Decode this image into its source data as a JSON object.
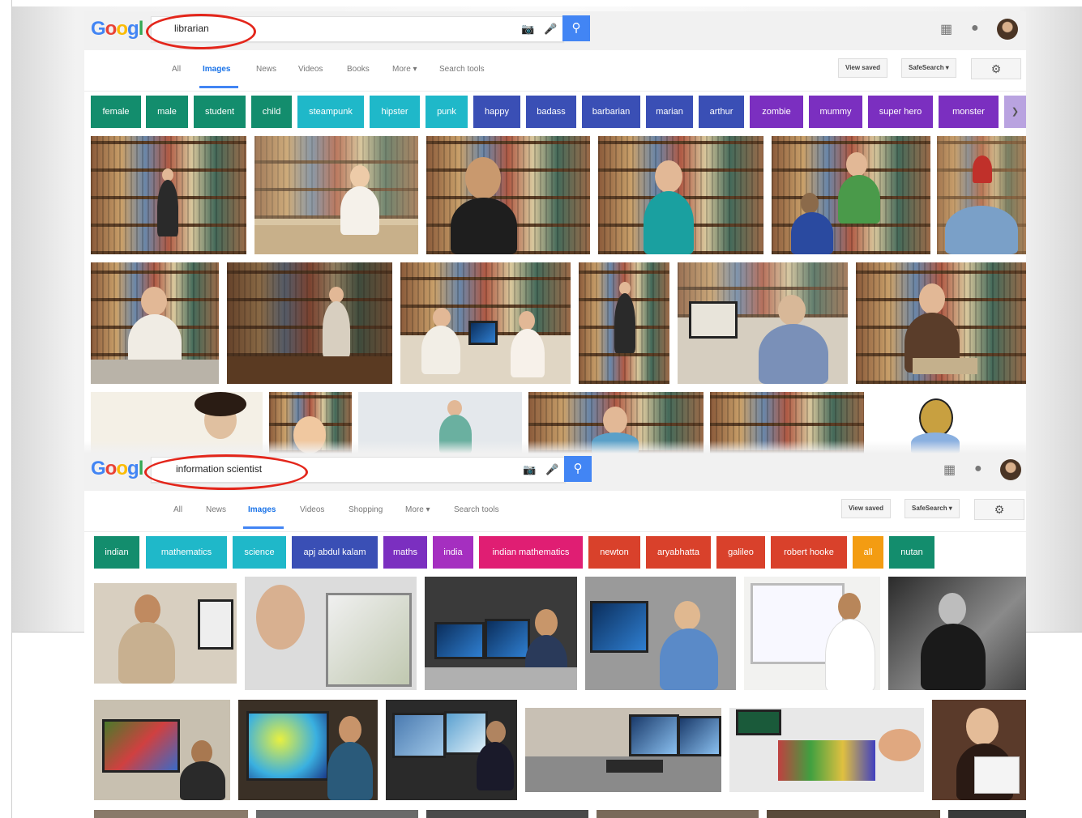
{
  "panels": [
    {
      "id": "librarian",
      "logo_text": "Googl",
      "query": "librarian",
      "nav": [
        "All",
        "Images",
        "News",
        "Videos",
        "Books",
        "More ▾",
        "Search tools"
      ],
      "active_nav": "Images",
      "view_saved": "View saved",
      "safesearch": "SafeSearch ▾",
      "chips": [
        {
          "label": "female",
          "color": "#138d6d"
        },
        {
          "label": "male",
          "color": "#138d6d"
        },
        {
          "label": "student",
          "color": "#138d6d"
        },
        {
          "label": "child",
          "color": "#138d6d"
        },
        {
          "label": "steampunk",
          "color": "#1fb8c9"
        },
        {
          "label": "hipster",
          "color": "#1fb8c9"
        },
        {
          "label": "punk",
          "color": "#1fb8c9"
        },
        {
          "label": "happy",
          "color": "#3a4fb5"
        },
        {
          "label": "badass",
          "color": "#3a4fb5"
        },
        {
          "label": "barbarian",
          "color": "#3a4fb5"
        },
        {
          "label": "marian",
          "color": "#3a4fb5"
        },
        {
          "label": "arthur",
          "color": "#3a4fb5"
        },
        {
          "label": "zombie",
          "color": "#7b2fc0"
        },
        {
          "label": "mummy",
          "color": "#7b2fc0"
        },
        {
          "label": "super hero",
          "color": "#7b2fc0"
        },
        {
          "label": "monster",
          "color": "#7b2fc0"
        }
      ]
    },
    {
      "id": "information-scientist",
      "logo_text": "Googl",
      "query": "information scientist",
      "nav": [
        "All",
        "News",
        "Images",
        "Videos",
        "Shopping",
        "More ▾",
        "Search tools"
      ],
      "active_nav": "Images",
      "view_saved": "View saved",
      "safesearch": "SafeSearch ▾",
      "chips": [
        {
          "label": "indian",
          "color": "#138d6d"
        },
        {
          "label": "mathematics",
          "color": "#1fb8c9"
        },
        {
          "label": "science",
          "color": "#1fb8c9"
        },
        {
          "label": "apj abdul kalam",
          "color": "#3a4fb5"
        },
        {
          "label": "maths",
          "color": "#7b2fc0"
        },
        {
          "label": "india",
          "color": "#a52fc0"
        },
        {
          "label": "indian mathematics",
          "color": "#e01e73"
        },
        {
          "label": "newton",
          "color": "#d9412b"
        },
        {
          "label": "aryabhatta",
          "color": "#d9412b"
        },
        {
          "label": "galileo",
          "color": "#d9412b"
        },
        {
          "label": "robert hooke",
          "color": "#d9412b"
        },
        {
          "label": "all",
          "color": "#f39c12"
        },
        {
          "label": "nutan",
          "color": "#138d6d"
        }
      ]
    }
  ],
  "icons": {
    "camera": "camera-icon",
    "mic": "microphone-icon",
    "search": "search-icon",
    "apps": "apps-grid-icon",
    "notifications": "notifications-icon",
    "settings": "gear-icon",
    "account": "avatar"
  },
  "colors": {
    "annotation_oval": "#e3261b",
    "search_button": "#4285f4",
    "active_tab": "#1a73e8"
  }
}
